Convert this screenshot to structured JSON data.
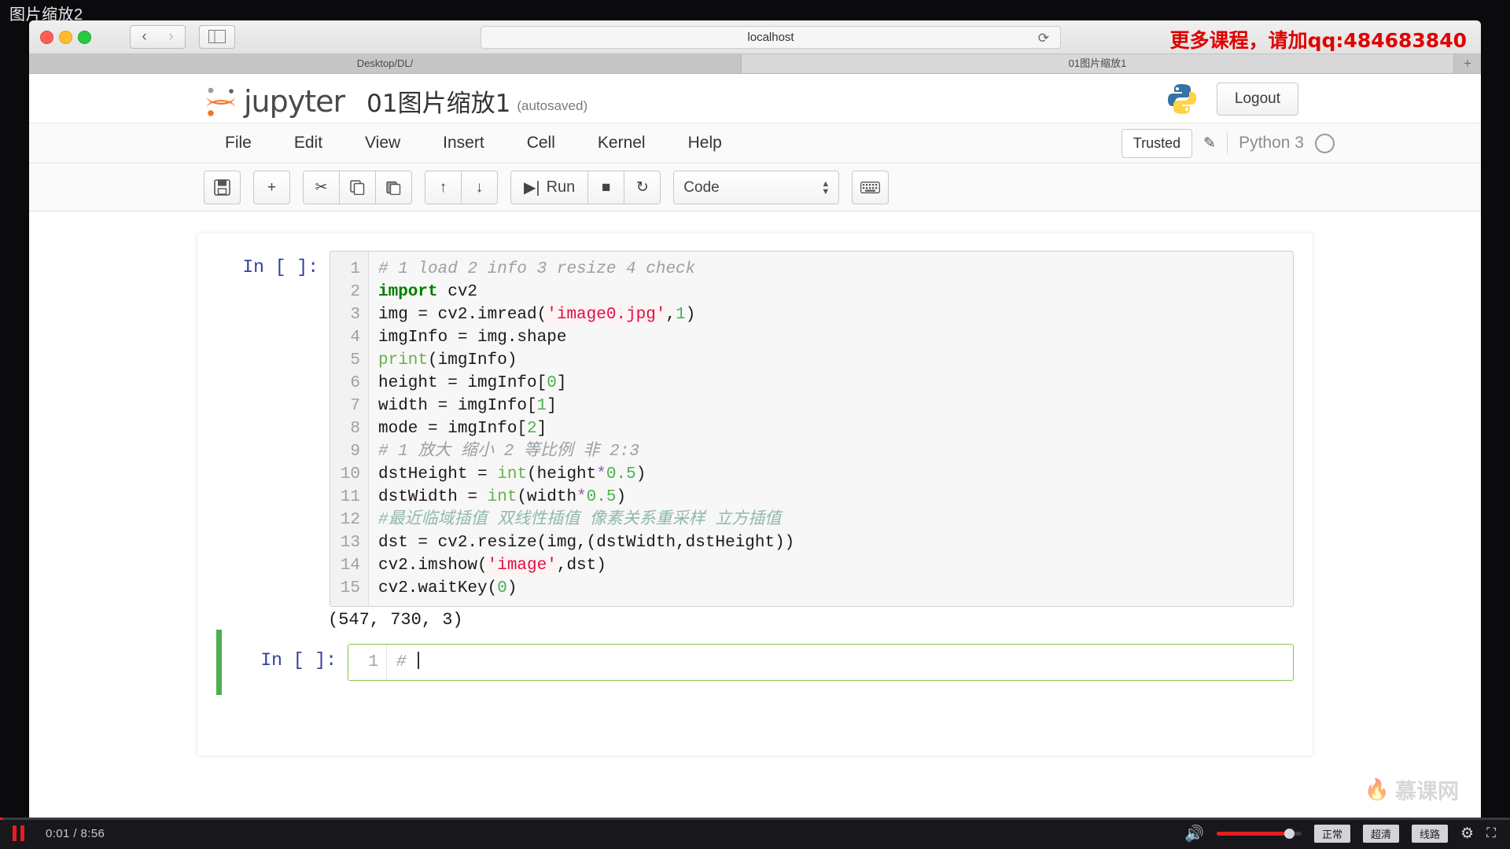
{
  "video": {
    "title": "图片缩放2",
    "time_label": "0:01 / 8:56",
    "play_state_icon": "pause-icon",
    "volume_icon": "speaker-icon",
    "quality_buttons": [
      "正常",
      "超清",
      "线路"
    ],
    "settings_icon": "gear-icon",
    "fullscreen_icon": "fullscreen-icon",
    "progress_percent": 0.2,
    "volume_percent": 86,
    "accent_color": "#e02020"
  },
  "browser": {
    "traffic_lights": [
      "close",
      "minimize",
      "maximize"
    ],
    "back_icon": "chevron-left-icon",
    "forward_icon": "chevron-right-icon",
    "sidebar_icon": "sidebar-toggle-icon",
    "url": "localhost",
    "reload_icon": "reload-icon",
    "banner_text": "更多课程，请加qq:484683840",
    "tabs": [
      {
        "label": "Desktop/DL/",
        "active": false
      },
      {
        "label": "01图片缩放1",
        "active": true
      }
    ],
    "new_tab_icon": "plus-icon"
  },
  "jupyter": {
    "wordmark": "jupyter",
    "notebook_name": "01图片缩放1",
    "autosave_label": "(autosaved)",
    "logout_label": "Logout",
    "python_logo": "python-logo-icon",
    "menu": [
      "File",
      "Edit",
      "View",
      "Insert",
      "Cell",
      "Kernel",
      "Help"
    ],
    "trusted_label": "Trusted",
    "edit_icon": "pencil-icon",
    "kernel_label": "Python 3",
    "kernel_status_icon": "kernel-idle-circle-icon",
    "toolbar": {
      "save_icon": "save-disk-icon",
      "insert_icon": "plus-icon",
      "cut_icon": "scissors-icon",
      "copy_icon": "copy-icon",
      "paste_icon": "paste-icon",
      "move_up_icon": "arrow-up-icon",
      "move_down_icon": "arrow-down-icon",
      "run_icon": "run-play-icon",
      "run_label": "Run",
      "stop_icon": "stop-square-icon",
      "restart_icon": "restart-circle-icon",
      "cell_type_value": "Code",
      "cell_type_arrows_icon": "updown-arrows-icon",
      "keyboard_icon": "keyboard-icon"
    },
    "cells": [
      {
        "prompt": "In [ ]:",
        "selected": false,
        "lines": [
          {
            "n": "1",
            "tokens": [
              {
                "t": "# 1 load 2 info 3 resize 4 check",
                "c": "cm"
              }
            ]
          },
          {
            "n": "2",
            "tokens": [
              {
                "t": "import",
                "c": "kw"
              },
              {
                "t": " cv2",
                "c": ""
              }
            ]
          },
          {
            "n": "3",
            "tokens": [
              {
                "t": "img = cv2.imread(",
                "c": ""
              },
              {
                "t": "'image0.jpg'",
                "c": "str"
              },
              {
                "t": ",",
                "c": ""
              },
              {
                "t": "1",
                "c": "num"
              },
              {
                "t": ")",
                "c": ""
              }
            ]
          },
          {
            "n": "4",
            "tokens": [
              {
                "t": "imgInfo = img.shape",
                "c": ""
              }
            ]
          },
          {
            "n": "5",
            "tokens": [
              {
                "t": "print",
                "c": "bi"
              },
              {
                "t": "(imgInfo)",
                "c": ""
              }
            ]
          },
          {
            "n": "6",
            "tokens": [
              {
                "t": "height = imgInfo[",
                "c": ""
              },
              {
                "t": "0",
                "c": "num"
              },
              {
                "t": "]",
                "c": ""
              }
            ]
          },
          {
            "n": "7",
            "tokens": [
              {
                "t": "width = imgInfo[",
                "c": ""
              },
              {
                "t": "1",
                "c": "num"
              },
              {
                "t": "]",
                "c": ""
              }
            ]
          },
          {
            "n": "8",
            "tokens": [
              {
                "t": "mode = imgInfo[",
                "c": ""
              },
              {
                "t": "2",
                "c": "num"
              },
              {
                "t": "]",
                "c": ""
              }
            ]
          },
          {
            "n": "9",
            "tokens": [
              {
                "t": "# 1 放大 缩小 2 等比例 非 2:3",
                "c": "cm"
              }
            ]
          },
          {
            "n": "10",
            "tokens": [
              {
                "t": "dstHeight = ",
                "c": ""
              },
              {
                "t": "int",
                "c": "bi"
              },
              {
                "t": "(height",
                "c": ""
              },
              {
                "t": "*",
                "c": "op"
              },
              {
                "t": "0.5",
                "c": "num"
              },
              {
                "t": ")",
                "c": ""
              }
            ]
          },
          {
            "n": "11",
            "tokens": [
              {
                "t": "dstWidth = ",
                "c": ""
              },
              {
                "t": "int",
                "c": "bi"
              },
              {
                "t": "(width",
                "c": ""
              },
              {
                "t": "*",
                "c": "op"
              },
              {
                "t": "0.5",
                "c": "num"
              },
              {
                "t": ")",
                "c": ""
              }
            ]
          },
          {
            "n": "12",
            "tokens": [
              {
                "t": "#最近临域插值 双线性插值 像素关系重采样 立方插值",
                "c": "cm-cjk"
              }
            ]
          },
          {
            "n": "13",
            "tokens": [
              {
                "t": "dst = cv2.resize(img,(dstWidth,dstHeight))",
                "c": ""
              }
            ]
          },
          {
            "n": "14",
            "tokens": [
              {
                "t": "cv2.imshow(",
                "c": ""
              },
              {
                "t": "'image'",
                "c": "str"
              },
              {
                "t": ",dst)",
                "c": ""
              }
            ]
          },
          {
            "n": "15",
            "tokens": [
              {
                "t": "cv2.waitKey(",
                "c": ""
              },
              {
                "t": "0",
                "c": "num"
              },
              {
                "t": ")",
                "c": ""
              }
            ]
          }
        ],
        "output": "(547, 730, 3)"
      },
      {
        "prompt": "In [ ]:",
        "selected": true,
        "lines": [
          {
            "n": "1",
            "tokens": [
              {
                "t": "#",
                "c": "cm"
              }
            ]
          }
        ],
        "output": null
      }
    ],
    "watermark_text": "慕课网",
    "watermark_icon": "flame-icon"
  }
}
